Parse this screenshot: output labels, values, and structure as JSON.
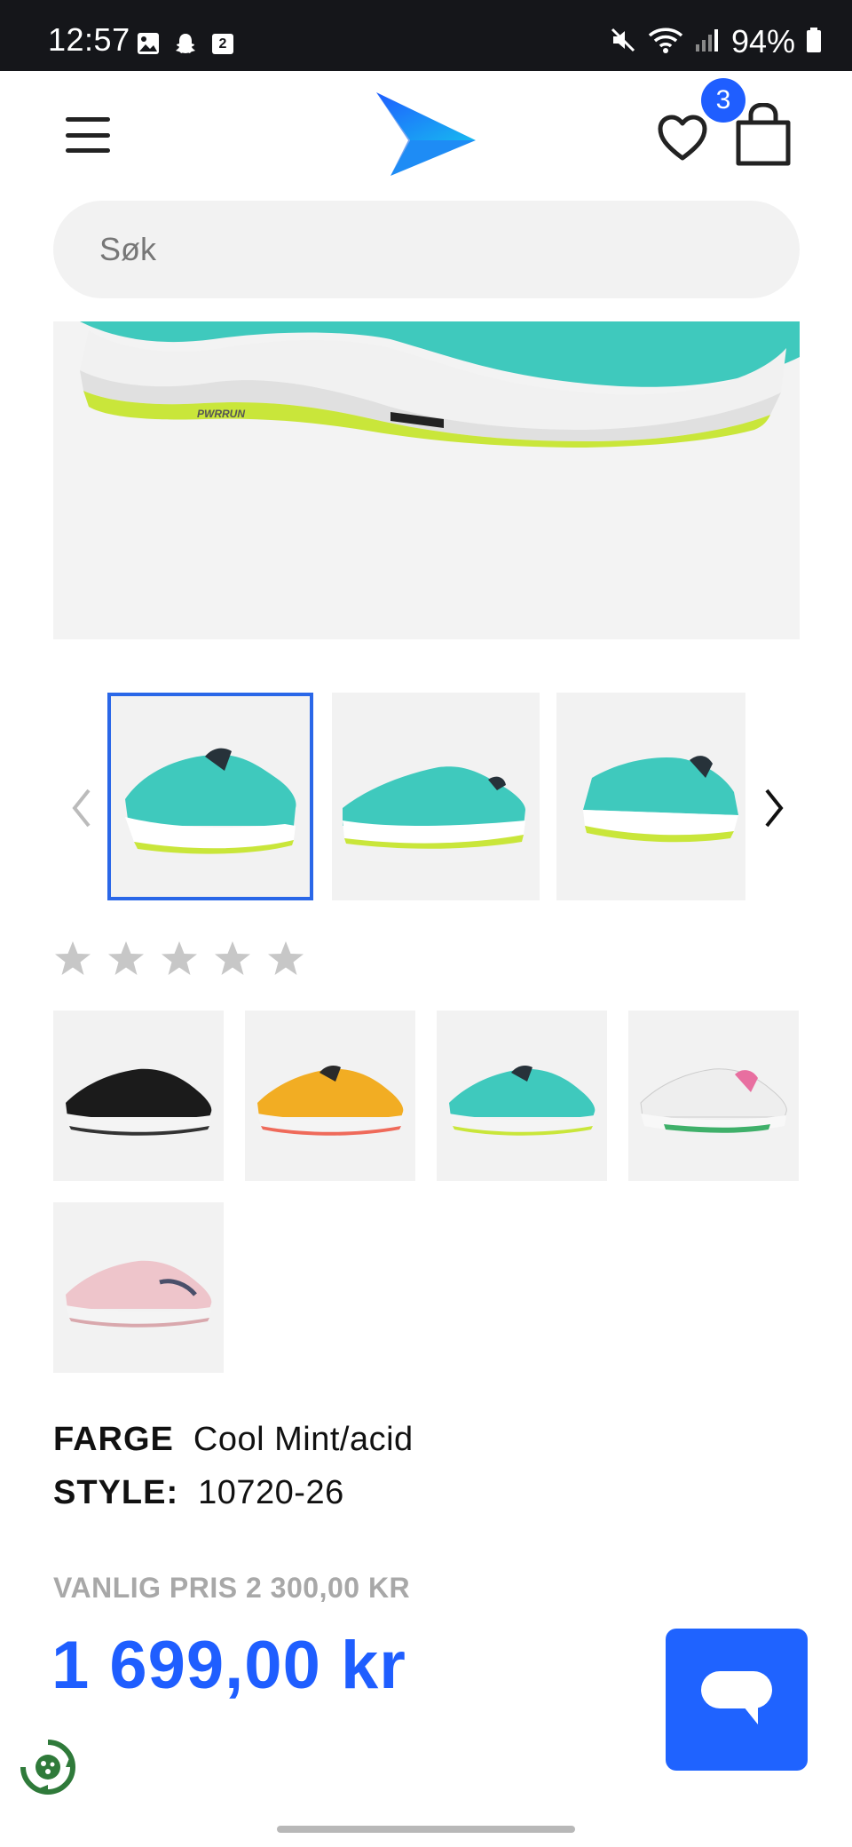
{
  "status_bar": {
    "time": "12:57",
    "calendar_day": "2",
    "battery": "94%"
  },
  "header": {
    "wishlist_count": "3"
  },
  "search": {
    "placeholder": "Søk"
  },
  "rating": {
    "stars_filled": 0,
    "stars_total": 5
  },
  "product": {
    "color_label": "FARGE",
    "color_value": "Cool Mint/acid",
    "style_label": "STYLE:",
    "style_value": "10720-26",
    "regular_price": "VANLIG PRIS 2 300,00 KR",
    "sale_price": "1 699,00 kr"
  },
  "colors": {
    "accent": "#1f5eff",
    "selected_outline": "#2a67e8",
    "mint": "#3fc9bd",
    "acid": "#c9e63a"
  },
  "swatches": [
    {
      "name": "black",
      "upper": "#1b1b1b"
    },
    {
      "name": "yellow",
      "upper": "#f2ad23"
    },
    {
      "name": "mint",
      "upper": "#3fc9bd"
    },
    {
      "name": "white",
      "upper": "#f2f2f2"
    },
    {
      "name": "pink",
      "upper": "#eec5cb"
    }
  ]
}
